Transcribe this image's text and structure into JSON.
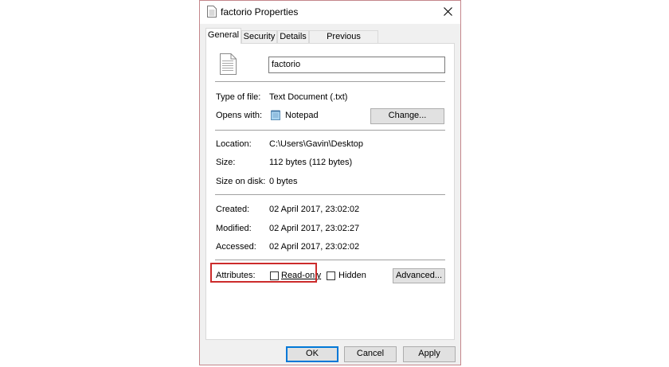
{
  "window": {
    "title": "factorio Properties"
  },
  "tabs": [
    {
      "label": "General",
      "active": true
    },
    {
      "label": "Security",
      "active": false
    },
    {
      "label": "Details",
      "active": false
    },
    {
      "label": "Previous Versions",
      "active": false
    }
  ],
  "general": {
    "file_name": "factorio",
    "type_label": "Type of file:",
    "type_value": "Text Document (.txt)",
    "opens_label": "Opens with:",
    "opens_value": "Notepad",
    "change_button": "Change...",
    "location_label": "Location:",
    "location_value": "C:\\Users\\Gavin\\Desktop",
    "size_label": "Size:",
    "size_value": "112 bytes (112 bytes)",
    "size_disk_label": "Size on disk:",
    "size_disk_value": "0 bytes",
    "created_label": "Created:",
    "created_value": "02 April 2017, 23:02:02",
    "modified_label": "Modified:",
    "modified_value": "02 April 2017, 23:02:27",
    "accessed_label": "Accessed:",
    "accessed_value": "02 April 2017, 23:02:02",
    "attributes_label": "Attributes:",
    "readonly_label": "Read-only",
    "readonly_checked": false,
    "hidden_label": "Hidden",
    "hidden_checked": false,
    "advanced_button": "Advanced..."
  },
  "footer": {
    "ok": "OK",
    "cancel": "Cancel",
    "apply": "Apply"
  },
  "colors": {
    "highlight": "#cc2b2b",
    "default_button_border": "#0078d7",
    "window_border": "#c4868b"
  }
}
